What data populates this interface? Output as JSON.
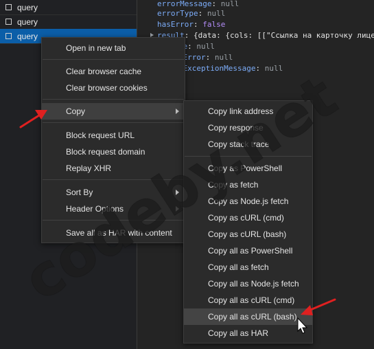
{
  "requests": [
    {
      "name": "query",
      "selected": false
    },
    {
      "name": "query",
      "selected": false
    },
    {
      "name": "query",
      "selected": true
    }
  ],
  "code": {
    "line1": {
      "key": "errorMessage",
      "sep": ": ",
      "val": "null"
    },
    "line2": {
      "key": "errorType",
      "sep": ": ",
      "val": "null"
    },
    "line3": {
      "key": "hasError",
      "sep": ": ",
      "val": "false"
    },
    "line4": {
      "key": "result",
      "sep": ": ",
      "val": "{data: {cols: [[\"Ссылка на карточку лице"
    },
    "line5": {
      "key": "trace",
      "sep": ": ",
      "val": "null"
    },
    "line6": {
      "key": "yingError",
      "sep": ": ",
      "val": "null"
    },
    "line7": {
      "key": "yingExceptionMessage",
      "sep": ": ",
      "val": "null"
    }
  },
  "context_menu": {
    "open_new_tab": "Open in new tab",
    "clear_cache": "Clear browser cache",
    "clear_cookies": "Clear browser cookies",
    "copy": "Copy",
    "block_url": "Block request URL",
    "block_domain": "Block request domain",
    "replay_xhr": "Replay XHR",
    "sort_by": "Sort By",
    "header_options": "Header Options",
    "save_har": "Save all as HAR with content"
  },
  "copy_menu": {
    "link_address": "Copy link address",
    "response": "Copy response",
    "stack_trace": "Copy stack trace",
    "as_powershell": "Copy as PowerShell",
    "as_fetch": "Copy as fetch",
    "as_node_fetch": "Copy as Node.js fetch",
    "as_curl_cmd": "Copy as cURL (cmd)",
    "as_curl_bash": "Copy as cURL (bash)",
    "all_powershell": "Copy all as PowerShell",
    "all_fetch": "Copy all as fetch",
    "all_node_fetch": "Copy all as Node.js fetch",
    "all_curl_cmd": "Copy all as cURL (cmd)",
    "all_curl_bash": "Copy all as cURL (bash)",
    "all_har": "Copy all as HAR"
  },
  "watermark": "codeby.net",
  "colors": {
    "selected_row": "#0b5ea8",
    "arrow": "#e02020",
    "watermark": "#1e1e1e"
  }
}
